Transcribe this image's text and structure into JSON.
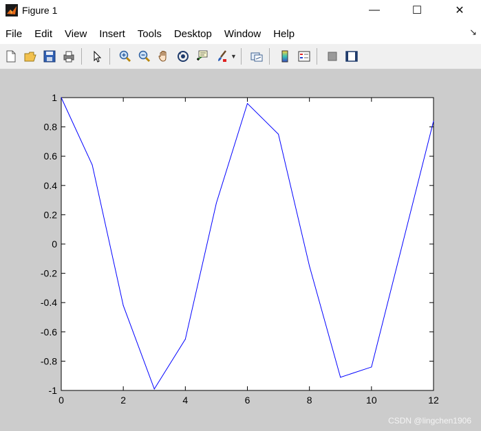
{
  "window": {
    "title": "Figure 1",
    "minimize_icon": "—",
    "maximize_icon": "☐",
    "close_icon": "✕"
  },
  "menu": {
    "items": [
      "File",
      "Edit",
      "View",
      "Insert",
      "Tools",
      "Desktop",
      "Window",
      "Help"
    ],
    "dock_arrow": "↘"
  },
  "toolbar": {
    "icons": [
      "new-figure-icon",
      "open-file-icon",
      "save-icon",
      "print-icon",
      "edit-plot-arrow-icon",
      "zoom-in-icon",
      "zoom-out-icon",
      "pan-hand-icon",
      "rotate-3d-icon",
      "data-cursor-icon",
      "brush-icon",
      "link-plot-icon",
      "colorbar-icon",
      "legend-icon",
      "hide-plot-tools-icon",
      "show-plot-tools-icon"
    ]
  },
  "chart_data": {
    "type": "line",
    "x": [
      0,
      1,
      2,
      3,
      4,
      5,
      6,
      7,
      8,
      9,
      10,
      11,
      12
    ],
    "series": [
      {
        "values": [
          1,
          0.54,
          -0.42,
          -0.99,
          -0.65,
          0.28,
          0.96,
          0.75,
          -0.15,
          -0.91,
          -0.84,
          0.0,
          0.84
        ],
        "color": "#0000ff"
      }
    ],
    "xlim": [
      0,
      12
    ],
    "ylim": [
      -1,
      1
    ],
    "xticks": [
      "0",
      "2",
      "4",
      "6",
      "8",
      "10",
      "12"
    ],
    "yticks": [
      "-1",
      "-0.8",
      "-0.6",
      "-0.4",
      "-0.2",
      "0",
      "0.2",
      "0.4",
      "0.6",
      "0.8",
      "1"
    ],
    "grid": false
  },
  "watermark": "CSDN @lingchen1906"
}
